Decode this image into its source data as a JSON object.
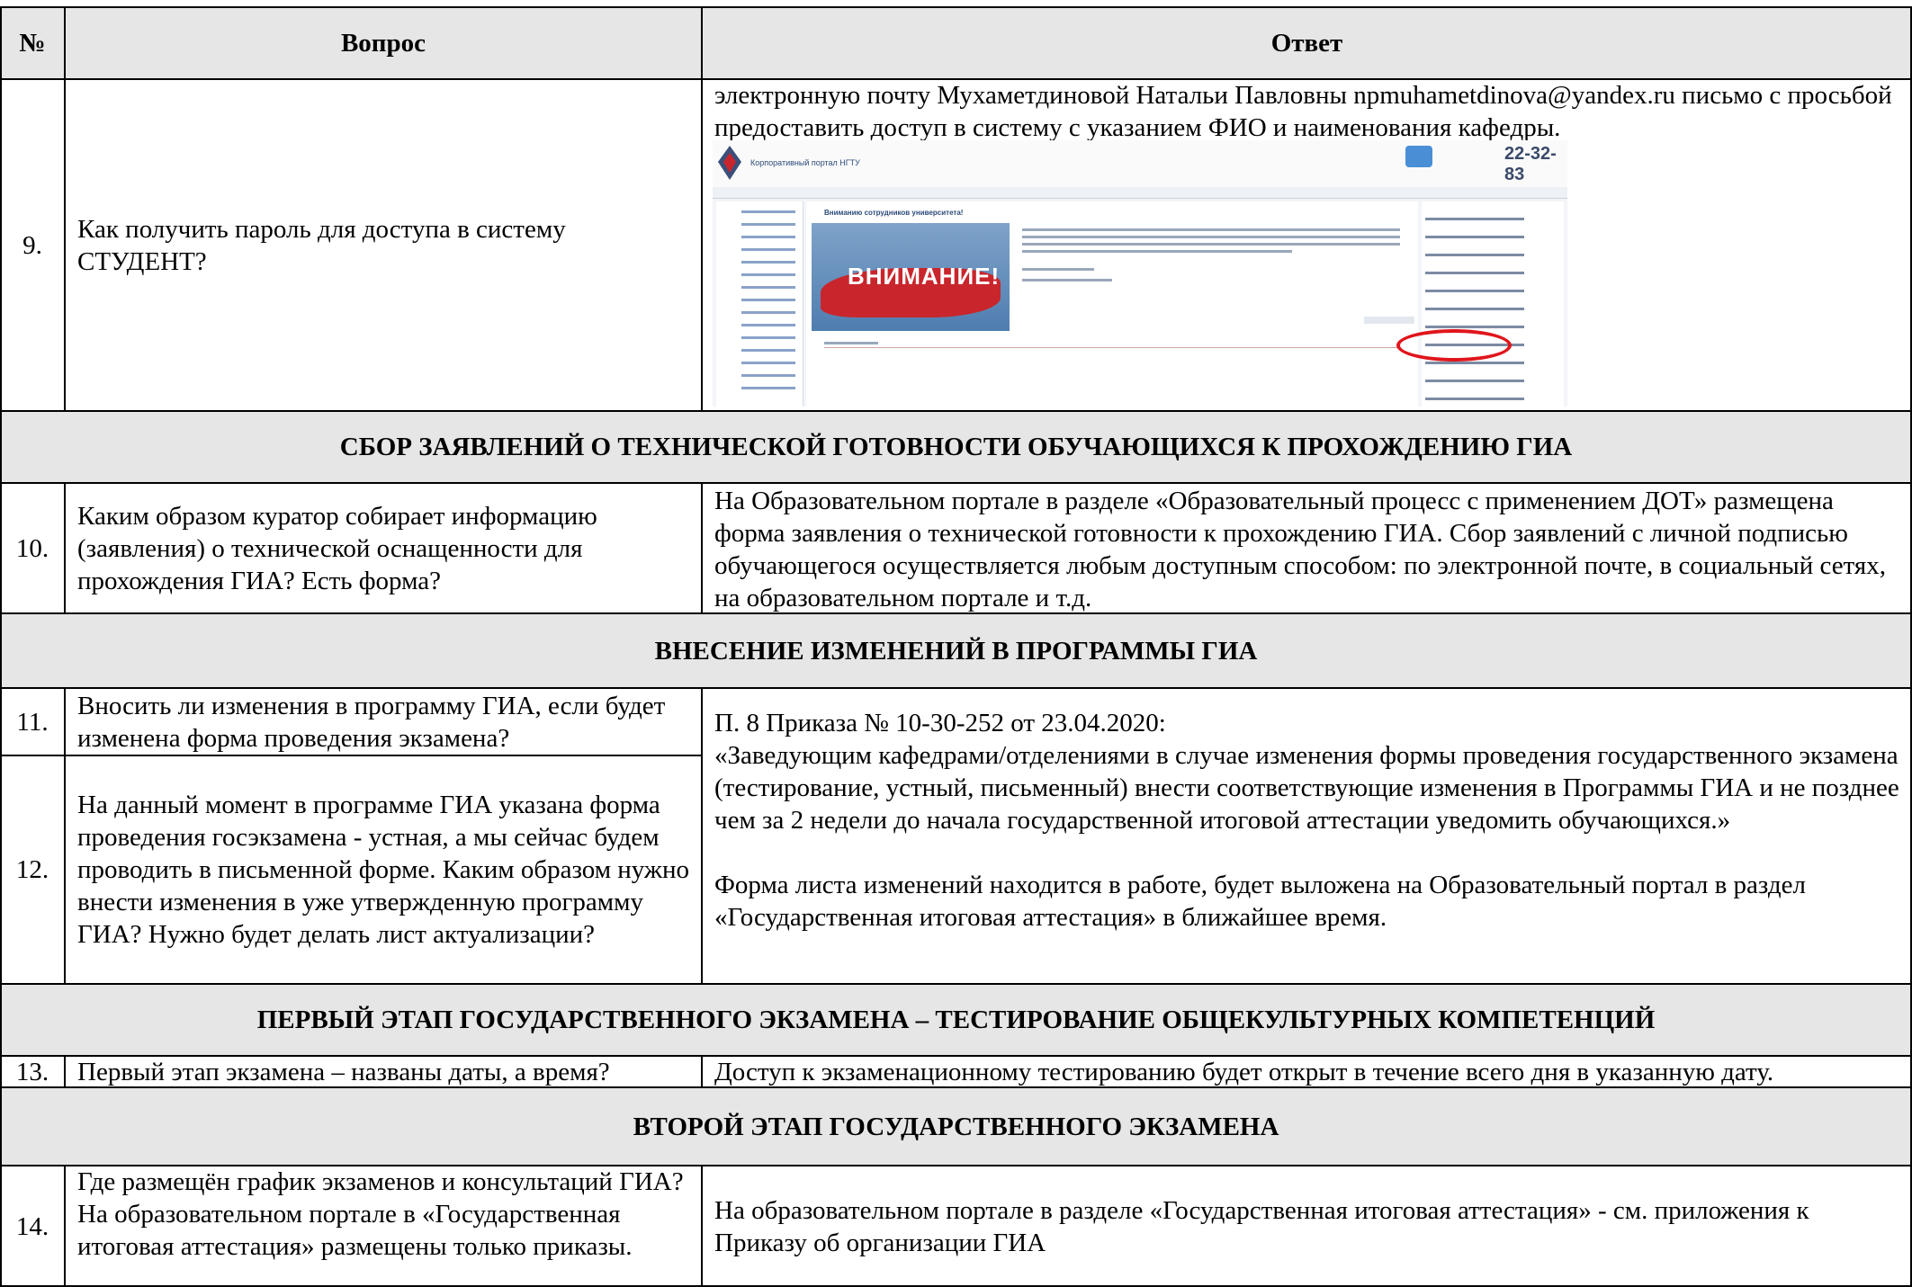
{
  "header": {
    "num": "№",
    "question": "Вопрос",
    "answer": "Ответ"
  },
  "rows": {
    "r9": {
      "num": "9.",
      "question": "Как получить пароль для доступа в систему СТУДЕНТ?",
      "answer": "электронную почту Мухаметдиновой Натальи Павловны npmuhametdinova@yandex.ru письмо с просьбой предоставить доступ в систему с указанием ФИО и наименования кафедры."
    },
    "r10": {
      "num": "10.",
      "question": "Каким образом куратор собирает информацию (заявления) о технической оснащенности для прохождения ГИА? Есть форма?",
      "answer": "На Образовательном портале в разделе «Образовательный процесс с применением ДОТ» размещена форма заявления о технической готовности к прохождению ГИА. Сбор заявлений с личной подписью обучающегося осуществляется любым доступным способом: по электронной почте, в социальный сетях, на образовательном портале и т.д."
    },
    "r11": {
      "num": "11.",
      "question": "Вносить ли изменения в программу ГИА, если будет изменена форма проведения экзамена?"
    },
    "r12": {
      "num": "12.",
      "question": "На данный момент в программе ГИА указана форма проведения госэкзамена - устная, а мы сейчас будем проводить в письменной форме. Каким образом нужно внести изменения в уже утвержденную программу ГИА? Нужно будет делать лист актуализации?"
    },
    "r11_12_answer": {
      "line1": "П. 8 Приказа № 10-30-252 от 23.04.2020:",
      "line2": "«Заведующим кафедрами/отделениями в случае изменения формы проведения государственного экзамена (тестирование, устный, письменный) внести соответствующие изменения в Программы ГИА и не позднее чем за 2 недели до начала государственной итоговой аттестации уведомить обучающихся.»",
      "line3": "Форма листа изменений находится в работе, будет выложена на Образовательный портал в раздел «Государственная итоговая аттестация» в ближайшее время."
    },
    "r13": {
      "num": "13.",
      "question": "Первый этап экзамена – названы даты, а время?",
      "answer": "Доступ к экзаменационному тестированию будет открыт в течение всего дня в указанную дату."
    },
    "r14": {
      "num": "14.",
      "question": "Где размещён график экзаменов и консультаций ГИА? На образовательном портале в «Государственная итоговая аттестация» размещены только приказы.",
      "answer": "На образовательном портале в разделе «Государственная итоговая аттестация»  - см. приложения к Приказу об организации ГИА"
    }
  },
  "sections": {
    "s1": "СБОР ЗАЯВЛЕНИЙ О ТЕХНИЧЕСКОЙ ГОТОВНОСТИ ОБУЧАЮЩИХСЯ К ПРОХОЖДЕНИЮ ГИА",
    "s2": "ВНЕСЕНИЕ ИЗМЕНЕНИЙ В ПРОГРАММЫ ГИА",
    "s3": "ПЕРВЫЙ ЭТАП ГОСУДАРСТВЕННОГО ЭКЗАМЕНА – ТЕСТИРОВАНИЕ ОБЩЕКУЛЬТУРНЫХ КОМПЕТЕНЦИЙ",
    "s4": "ВТОРОЙ ЭТАП ГОСУДАРСТВЕННОГО ЭКЗАМЕНА"
  },
  "screenshot": {
    "portal_title": "Корпоративный портал НГТУ",
    "phone": "22-32-83",
    "banner_text": "ВНИМАНИЕ!",
    "notice_title": "Вниманию сотрудников университета!",
    "highlight_color": "#e0151b"
  }
}
